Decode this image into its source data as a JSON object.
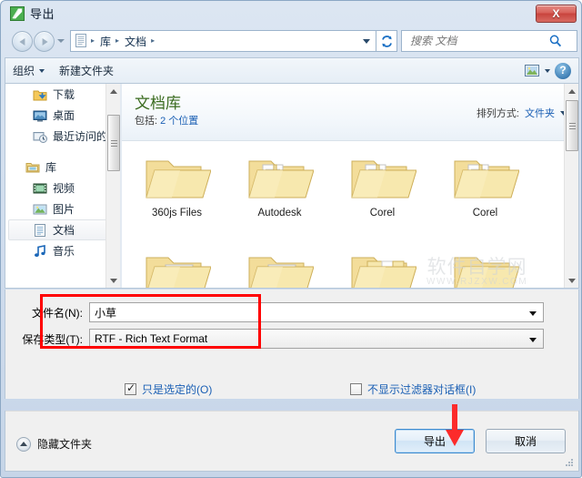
{
  "window": {
    "title": "导出",
    "title_icon": "app-icon",
    "close_label": "X"
  },
  "nav": {
    "back_tooltip": "后退",
    "forward_tooltip": "前进",
    "breadcrumbs": [
      "库",
      "文档"
    ],
    "separator": "▸",
    "refresh_icon": "refresh-icon",
    "dropdown_icon": "chevron-down-icon"
  },
  "search": {
    "placeholder": "搜索 文档",
    "value": "",
    "icon": "search-icon"
  },
  "toolbar": {
    "organize_label": "组织",
    "newfolder_label": "新建文件夹",
    "view_icon": "view-mode-icon",
    "help_label": "?"
  },
  "sidebar": {
    "items": [
      {
        "label": "下载",
        "icon": "downloads-icon",
        "indent": true,
        "selected": false
      },
      {
        "label": "桌面",
        "icon": "desktop-icon",
        "indent": true,
        "selected": false
      },
      {
        "label": "最近访问的",
        "icon": "recent-places-icon",
        "indent": true,
        "selected": false
      },
      {
        "label": "库",
        "icon": "libraries-icon",
        "indent": false,
        "selected": false
      },
      {
        "label": "视频",
        "icon": "videos-icon",
        "indent": true,
        "selected": false
      },
      {
        "label": "图片",
        "icon": "pictures-icon",
        "indent": true,
        "selected": false
      },
      {
        "label": "文档",
        "icon": "documents-icon",
        "indent": true,
        "selected": true
      },
      {
        "label": "音乐",
        "icon": "music-icon",
        "indent": true,
        "selected": false
      }
    ]
  },
  "library": {
    "title": "文档库",
    "subtitle_prefix": "包括:",
    "subtitle_link": "2 个位置",
    "arrange_label": "排列方式:",
    "arrange_value": "文件夹"
  },
  "files": {
    "row1": [
      {
        "name": "360js Files",
        "type": "folder-empty"
      },
      {
        "name": "Autodesk",
        "type": "folder-full"
      },
      {
        "name": "Corel",
        "type": "folder-full"
      },
      {
        "name": "Corel",
        "type": "folder-full"
      }
    ],
    "row2": [
      {
        "name": "",
        "type": "folder-doc-dark"
      },
      {
        "name": "",
        "type": "folder-doc-light"
      },
      {
        "name": "",
        "type": "folder-pages"
      },
      {
        "name": "",
        "type": "folder-empty"
      }
    ]
  },
  "form": {
    "filename_label": "文件名(N):",
    "filename_value": "小草",
    "filetype_label": "保存类型(T):",
    "filetype_value": "RTF - Rich Text Format"
  },
  "options": {
    "selected_only_label": "只是选定的(O)",
    "selected_only_checked": true,
    "no_filter_dialog_label": "不显示过滤器对话框(I)",
    "no_filter_dialog_checked": false
  },
  "bottom": {
    "hide_folders_label": "隐藏文件夹",
    "export_label": "导出",
    "cancel_label": "取消"
  },
  "annotations": {
    "highlight_color": "#ff0000",
    "arrow_color": "#ff2a2a"
  },
  "watermark": {
    "main": "软件自学网",
    "sub": "WWW.RJZXW.COM"
  }
}
